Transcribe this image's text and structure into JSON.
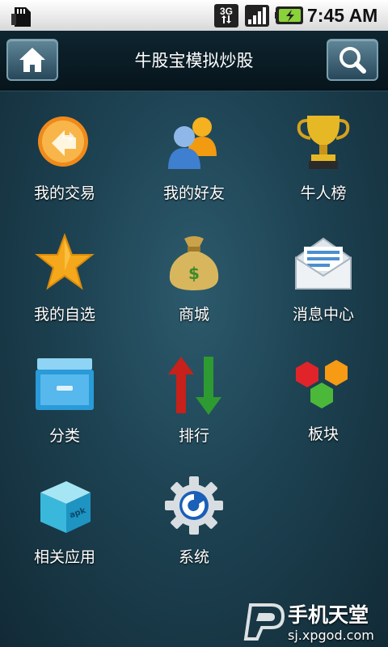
{
  "status_bar": {
    "time": "7:45 AM",
    "network": "3G",
    "icons": [
      "sd-card-icon",
      "3g-data-icon",
      "signal-icon",
      "battery-charging-icon"
    ]
  },
  "header": {
    "title": "牛股宝模拟炒股",
    "left_icon": "home-icon",
    "right_icon": "search-icon"
  },
  "grid": {
    "items": [
      {
        "label": "我的交易",
        "icon": "trade-arrows-icon"
      },
      {
        "label": "我的好友",
        "icon": "friends-icon"
      },
      {
        "label": "牛人榜",
        "icon": "trophy-icon"
      },
      {
        "label": "我的自选",
        "icon": "star-icon"
      },
      {
        "label": "商城",
        "icon": "money-bag-icon"
      },
      {
        "label": "消息中心",
        "icon": "envelope-icon"
      },
      {
        "label": "分类",
        "icon": "drawer-icon"
      },
      {
        "label": "排行",
        "icon": "up-down-arrows-icon"
      },
      {
        "label": "板块",
        "icon": "blocks-icon"
      },
      {
        "label": "相关应用",
        "icon": "apk-box-icon"
      },
      {
        "label": "系统",
        "icon": "settings-gear-icon"
      }
    ]
  },
  "watermark": {
    "title": "手机天堂",
    "url": "sj.xpgod.com"
  },
  "colors": {
    "background": "#1d4252",
    "header": "#07141b",
    "label_text": "#ffffff"
  }
}
